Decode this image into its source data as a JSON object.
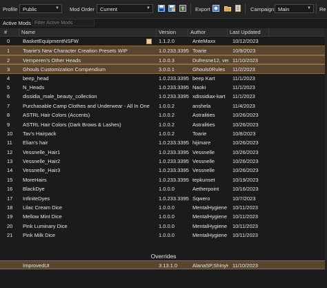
{
  "toolbar": {
    "profile_label": "Profile",
    "profile_value": "Public",
    "mod_order_label": "Mod Order",
    "mod_order_value": "Current",
    "export_label": "Export",
    "campaign_label": "Campaign",
    "campaign_value": "Main",
    "cut_label": "Re",
    "icons": [
      "save-icon",
      "save-as-icon",
      "export-order-icon",
      "export-icon-1",
      "export-icon-2",
      "export-icon-3"
    ]
  },
  "filter": {
    "label": "Active Mods",
    "placeholder": "Filter Active Mods"
  },
  "columns": {
    "index": "#",
    "name": "Name",
    "version": "Version",
    "author": "Author",
    "last_updated": "Last Updated"
  },
  "rows": [
    {
      "index": "0",
      "name": "BasketEquipmentNSFW",
      "version": "1.1.2.0",
      "author": "AnteMaxx",
      "date": "10/12/2023",
      "highlight": false,
      "note": true
    },
    {
      "index": "1",
      "name": "Toarie's New Character Creation Presets WIP",
      "version": "1.0.233.3395",
      "author": "Toarie",
      "date": "10/9/2023",
      "highlight": true,
      "note": false
    },
    {
      "index": "2",
      "name": "Vemperen's Other Heads",
      "version": "1.0.0.3",
      "author": "Dufresne12, vem",
      "date": "11/10/2023",
      "highlight": true,
      "note": false
    },
    {
      "index": "3",
      "name": "Ghouls Customization Compendium",
      "version": "3.0.0.1",
      "author": "Ghouls0Rules",
      "date": "11/2/2023",
      "highlight": true,
      "note": false
    },
    {
      "index": "4",
      "name": "beep_head",
      "version": "1.0.233.3395",
      "author": "beep Kart",
      "date": "11/1/2023",
      "highlight": false,
      "note": false
    },
    {
      "index": "5",
      "name": "N_Heads",
      "version": "1.0.233.3395",
      "author": "Naoki",
      "date": "11/1/2023",
      "highlight": false,
      "note": false
    },
    {
      "index": "6",
      "name": "dissidia_male_beauty_collection",
      "version": "1.0.233.3395",
      "author": "xdissidiax-kart",
      "date": "11/1/2023",
      "highlight": false,
      "note": false
    },
    {
      "index": "7",
      "name": "Purchasable Camp Clothes and Underwear - All In One",
      "version": "1.0.0.2",
      "author": "anshela",
      "date": "11/4/2023",
      "highlight": false,
      "note": false
    },
    {
      "index": "8",
      "name": "ASTRL Hair Colors (Accents)",
      "version": "1.0.0.2",
      "author": "Astralities",
      "date": "10/26/2023",
      "highlight": false,
      "note": false
    },
    {
      "index": "9",
      "name": "ASTRL Hair Colors (Dark Brows & Lashes)",
      "version": "1.0.0.2",
      "author": "Astralities",
      "date": "10/26/2023",
      "highlight": false,
      "note": false
    },
    {
      "index": "10",
      "name": "Tav's Hairpack",
      "version": "1.0.0.2",
      "author": "Toarie",
      "date": "10/8/2023",
      "highlight": false,
      "note": false
    },
    {
      "index": "11",
      "name": "Elian's hair",
      "version": "1.0.233.3395",
      "author": "hijimare",
      "date": "10/26/2023",
      "highlight": false,
      "note": false
    },
    {
      "index": "12",
      "name": "Vessnelle_Hair1",
      "version": "1.0.233.3395",
      "author": "Vessnelle",
      "date": "10/26/2023",
      "highlight": false,
      "note": false
    },
    {
      "index": "13",
      "name": "Vessnelle_Hair2",
      "version": "1.0.233.3395",
      "author": "Vessnelle",
      "date": "10/26/2023",
      "highlight": false,
      "note": false
    },
    {
      "index": "14",
      "name": "Vessnelle_Hair3",
      "version": "1.0.233.3395",
      "author": "Vessnelle",
      "date": "10/26/2023",
      "highlight": false,
      "note": false
    },
    {
      "index": "15",
      "name": "MoreHairs",
      "version": "1.0.233.3395",
      "author": "tepkunset",
      "date": "10/19/2023",
      "highlight": false,
      "note": false
    },
    {
      "index": "16",
      "name": "BlackDye",
      "version": "1.0.0.0",
      "author": "Aetherpoint",
      "date": "10/16/2023",
      "highlight": false,
      "note": false
    },
    {
      "index": "17",
      "name": "InfiniteDyes",
      "version": "1.0.233.3395",
      "author": "Sqwero",
      "date": "10/7/2023",
      "highlight": false,
      "note": false
    },
    {
      "index": "18",
      "name": "Lilac Cream Dice",
      "version": "1.0.0.0",
      "author": "MentalHygiene",
      "date": "10/11/2023",
      "highlight": false,
      "note": false
    },
    {
      "index": "19",
      "name": "Mellow Mint Dice",
      "version": "1.0.0.0",
      "author": "MentalHygiene",
      "date": "10/11/2023",
      "highlight": false,
      "note": false
    },
    {
      "index": "20",
      "name": "Pink Luminary Dice",
      "version": "1.0.0.0",
      "author": "MentalHygiene",
      "date": "10/11/2023",
      "highlight": false,
      "note": false
    },
    {
      "index": "21",
      "name": "Pink Milk Dice",
      "version": "1.0.0.0",
      "author": "MentalHygiene",
      "date": "10/11/2023",
      "highlight": false,
      "note": false
    }
  ],
  "overrides": {
    "title": "Overrides",
    "row": {
      "name": "ImprovedUI",
      "version": "3.13.1.0",
      "author": "AlanaSP,ShinyHc",
      "date": "11/10/2023"
    }
  },
  "colors": {
    "background": "#1b1b1b",
    "highlight_row": "#5a452e",
    "highlight_border": "#8a6c45"
  }
}
